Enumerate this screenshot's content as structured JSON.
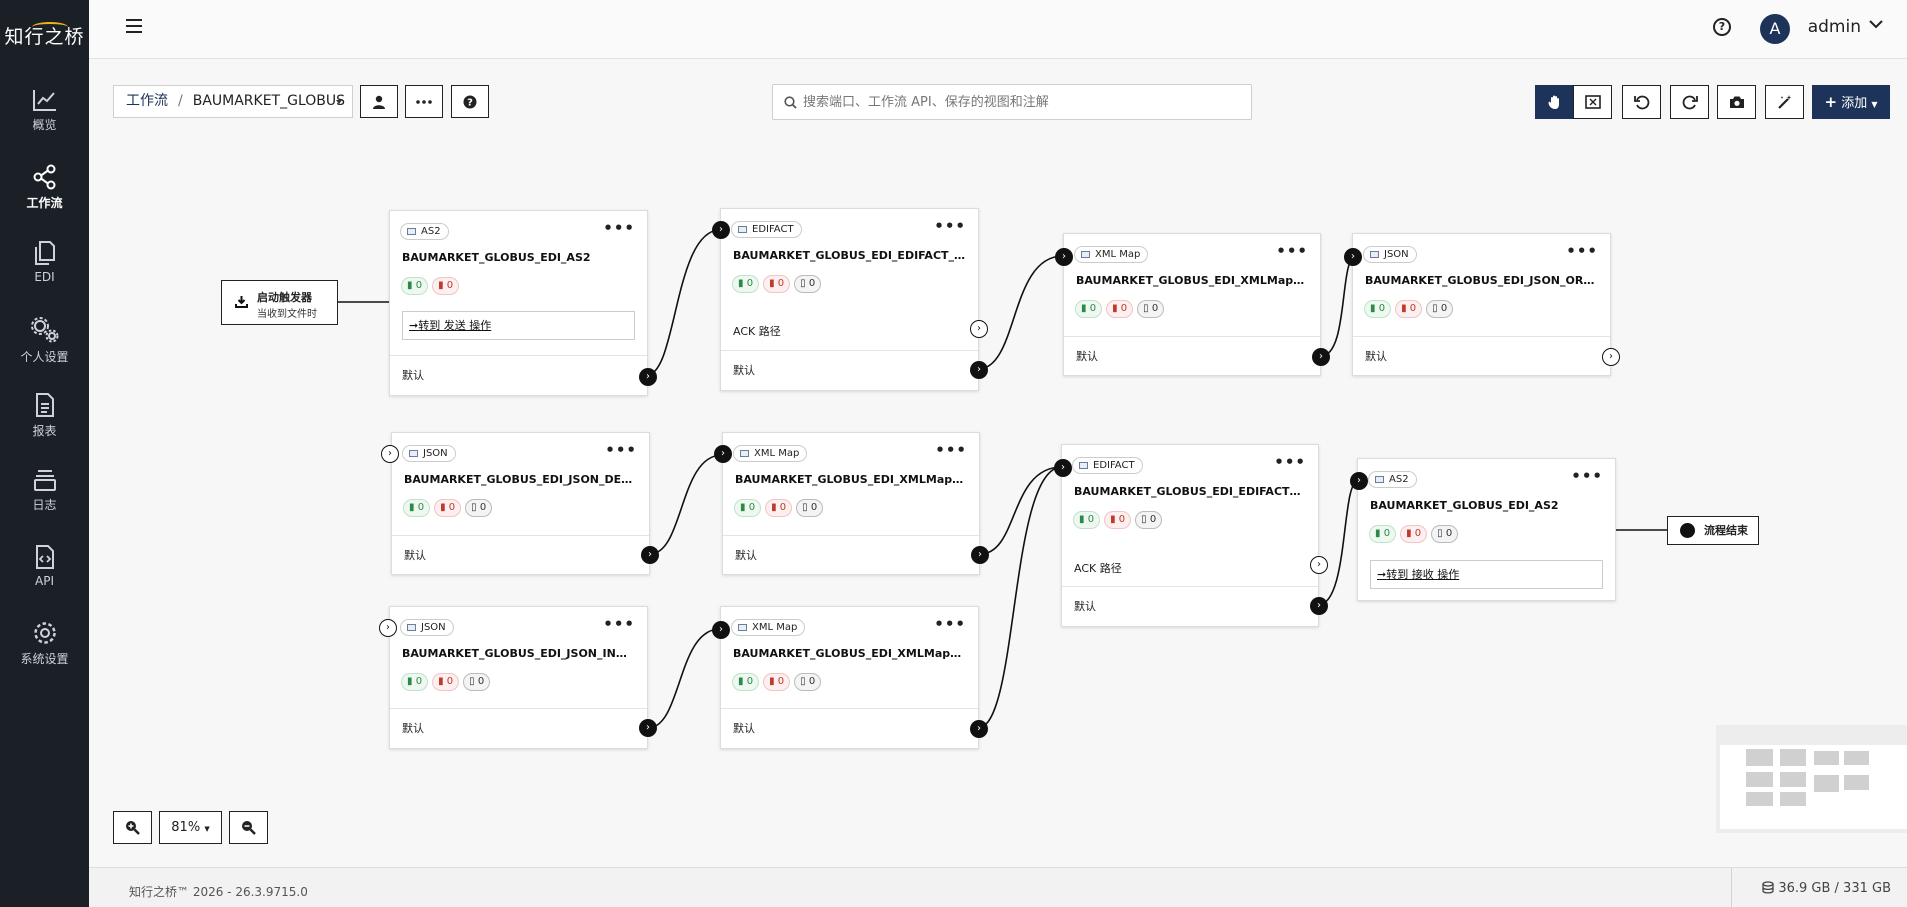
{
  "app": {
    "logo_text": "知行之桥"
  },
  "sidebar": {
    "items": [
      {
        "label": "概览",
        "icon": "chart-line-icon"
      },
      {
        "label": "工作流",
        "icon": "share-nodes-icon"
      },
      {
        "label": "EDI",
        "icon": "documents-icon"
      },
      {
        "label": "个人设置",
        "icon": "gears-icon"
      },
      {
        "label": "报表",
        "icon": "report-icon"
      },
      {
        "label": "日志",
        "icon": "layers-icon"
      },
      {
        "label": "API",
        "icon": "api-file-icon"
      },
      {
        "label": "系统设置",
        "icon": "gear-icon"
      }
    ]
  },
  "header": {
    "help": "?",
    "avatar_letter": "A",
    "user": "admin"
  },
  "toolbar": {
    "breadcrumb_root": "工作流",
    "breadcrumb_current": "BAUMARKET_GLOBUS",
    "search_placeholder": "搜索端口、工作流 API、保存的视图和注解",
    "add_label": "添加",
    "accent": "#1d3359"
  },
  "flow": {
    "trigger": {
      "title": "启动触发器",
      "subtitle": "当收到文件时"
    },
    "end": {
      "label": "流程结束"
    },
    "nodes": [
      {
        "type": "AS2",
        "title": "BAUMARKET_GLOBUS_EDI_AS2",
        "success": "0",
        "error": "0",
        "link": "转到 发送 操作",
        "default": "默认"
      },
      {
        "type": "EDIFACT",
        "title": "BAUMARKET_GLOBUS_EDI_EDIFACT_IN",
        "success": "0",
        "error": "0",
        "pending": "0",
        "ack": "ACK 路径",
        "default": "默认"
      },
      {
        "type": "XML Map",
        "title": "BAUMARKET_GLOBUS_EDI_XMLMap_ORD...",
        "success": "0",
        "error": "0",
        "pending": "0",
        "default": "默认"
      },
      {
        "type": "JSON",
        "title": "BAUMARKET_GLOBUS_EDI_JSON_ORDERS...",
        "success": "0",
        "error": "0",
        "pending": "0",
        "default": "默认"
      },
      {
        "type": "JSON",
        "title": "BAUMARKET_GLOBUS_EDI_JSON_DESADV...",
        "success": "0",
        "error": "0",
        "pending": "0",
        "default": "默认"
      },
      {
        "type": "XML Map",
        "title": "BAUMARKET_GLOBUS_EDI_XMLMap_DESA...",
        "success": "0",
        "error": "0",
        "pending": "0",
        "default": "默认"
      },
      {
        "type": "EDIFACT",
        "title": "BAUMARKET_GLOBUS_EDI_EDIFACT_OUT",
        "success": "0",
        "error": "0",
        "pending": "0",
        "ack": "ACK 路径",
        "default": "默认"
      },
      {
        "type": "AS2",
        "title": "BAUMARKET_GLOBUS_EDI_AS2",
        "success": "0",
        "error": "0",
        "pending": "0",
        "link": "转到 接收 操作"
      },
      {
        "type": "JSON",
        "title": "BAUMARKET_GLOBUS_EDI_JSON_INVOIC_...",
        "success": "0",
        "error": "0",
        "pending": "0",
        "default": "默认"
      },
      {
        "type": "XML Map",
        "title": "BAUMARKET_GLOBUS_EDI_XMLMap_INVO...",
        "success": "0",
        "error": "0",
        "pending": "0",
        "default": "默认"
      }
    ]
  },
  "zoom": {
    "level": "81%"
  },
  "footer": {
    "version": "知行之桥™ 2026 - 26.3.9715.0",
    "disk": "36.9 GB / 331 GB"
  }
}
